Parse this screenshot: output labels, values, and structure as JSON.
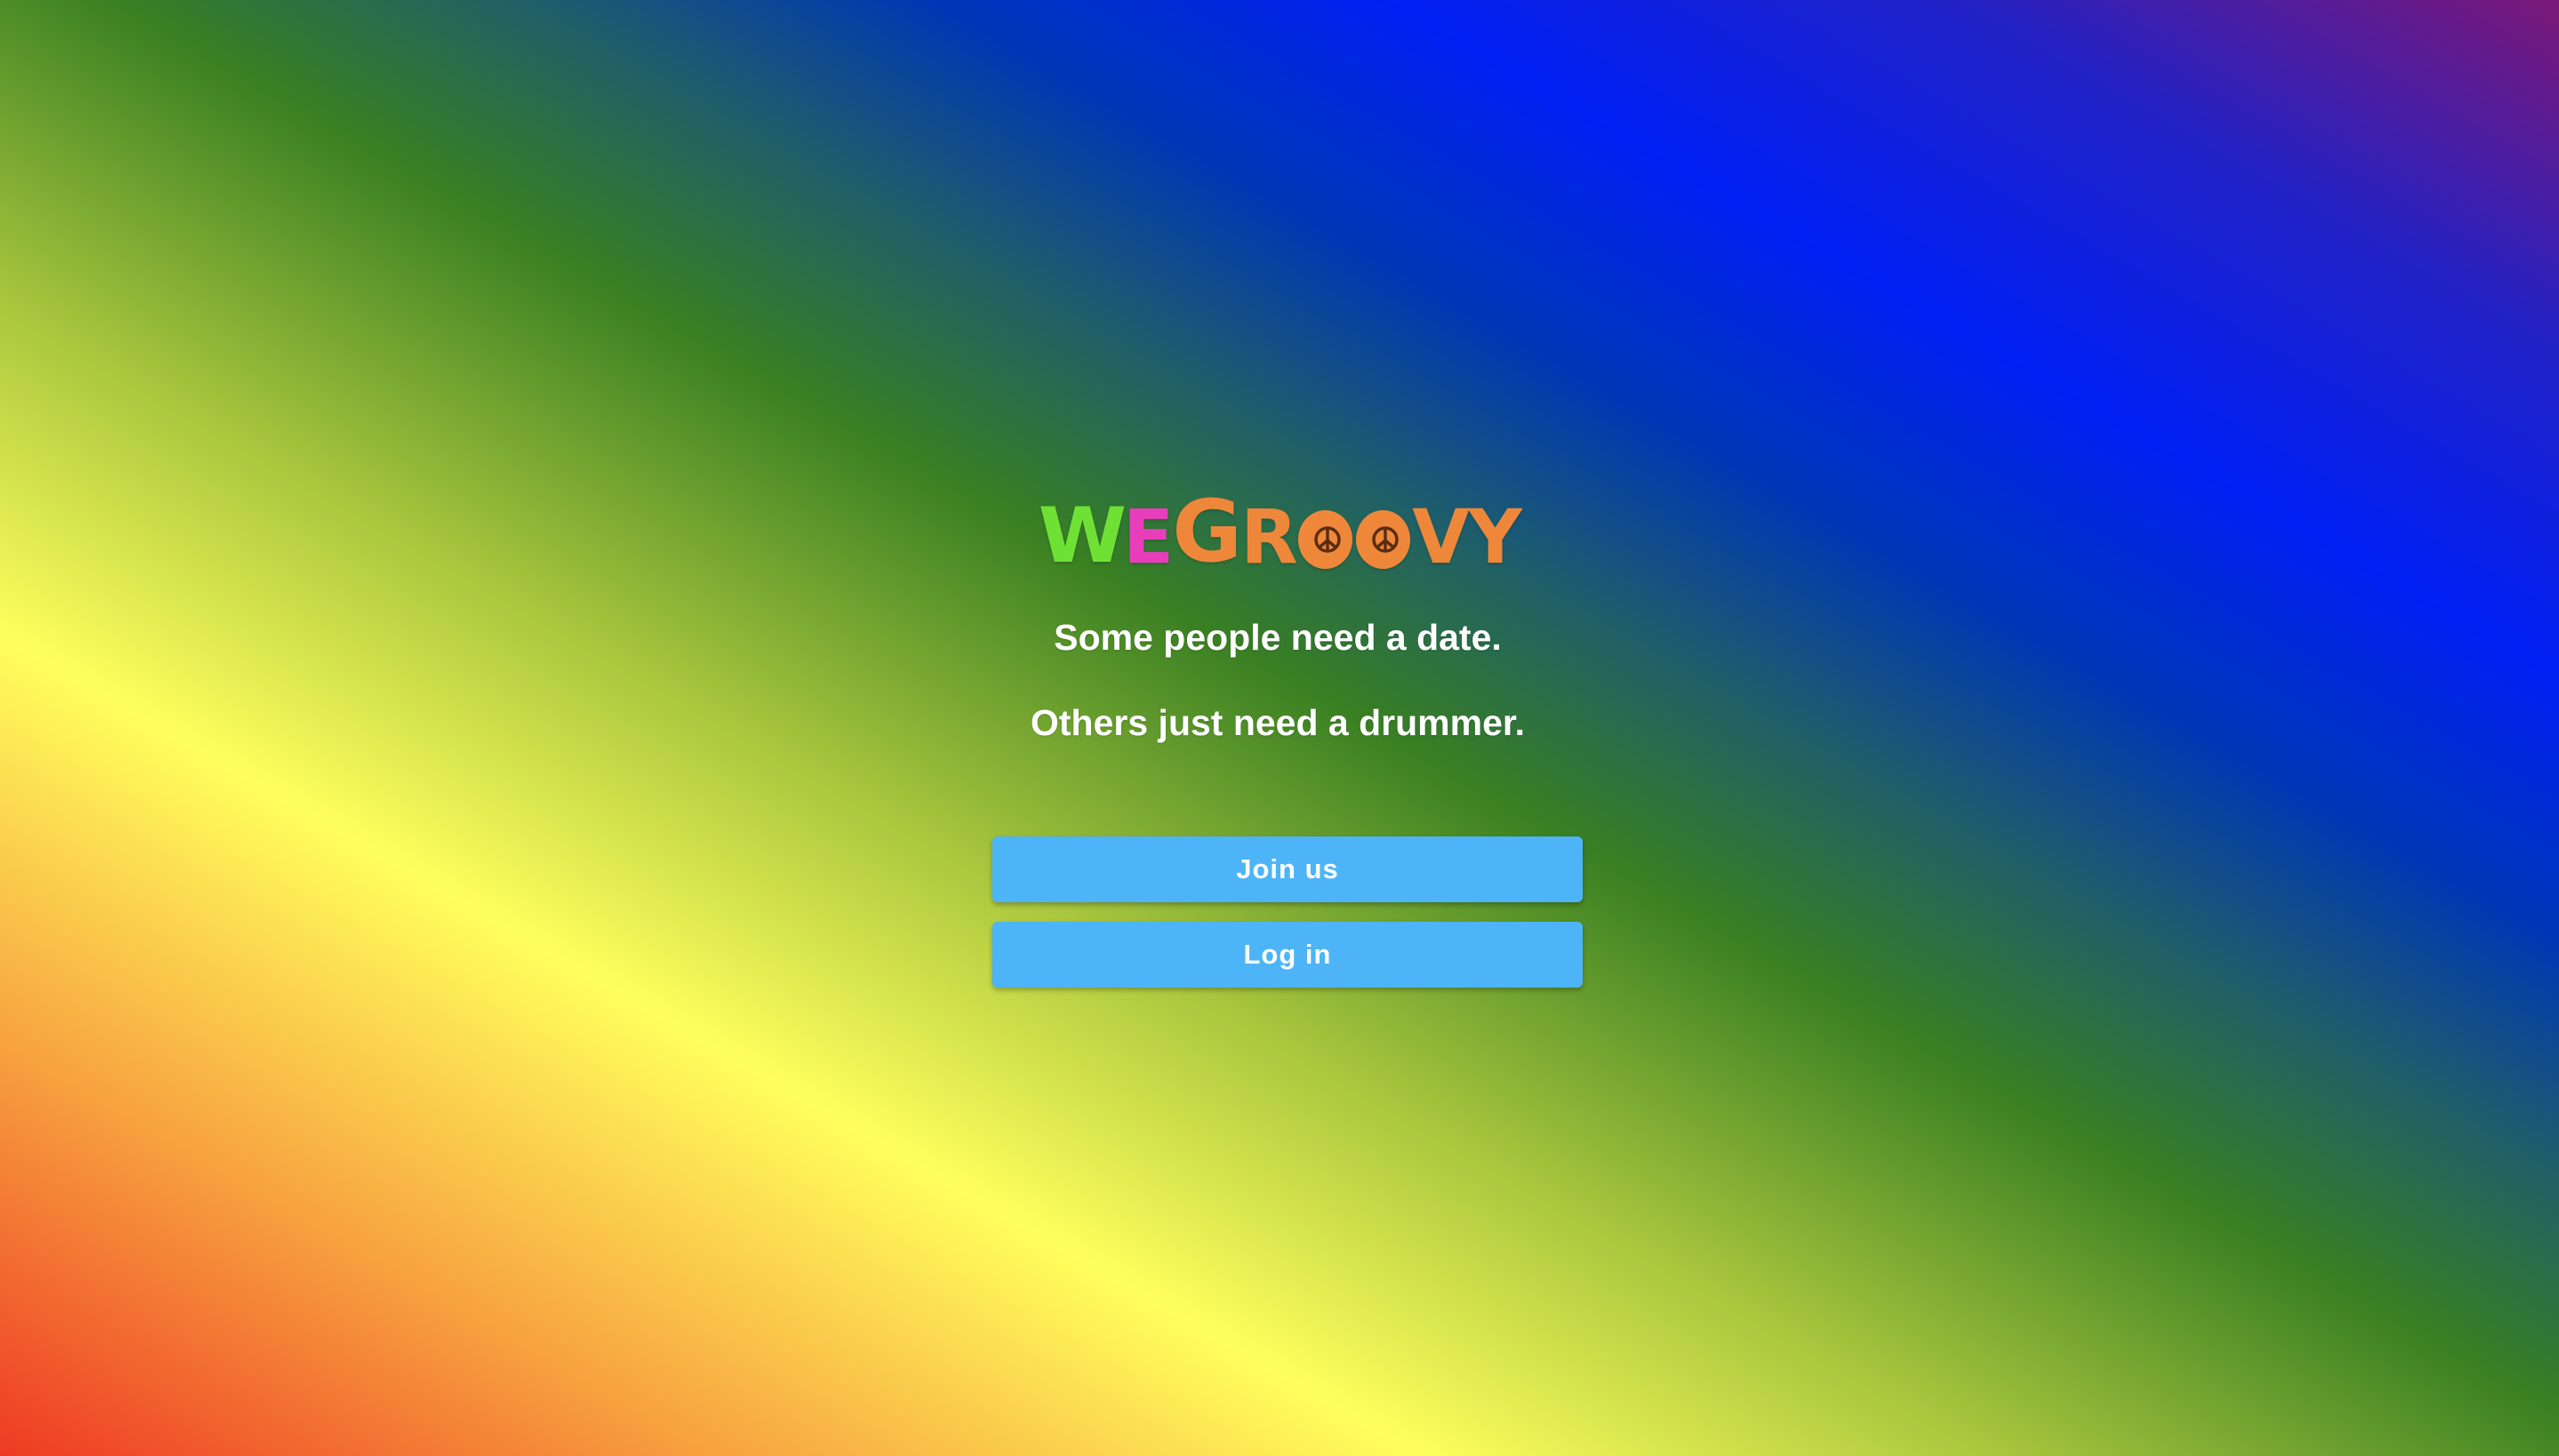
{
  "logo": {
    "letters": [
      "W",
      "E",
      "G",
      "R",
      "O",
      "O",
      "V",
      "Y"
    ],
    "text": "WEGROOVY",
    "colors": {
      "w": "#6fe135",
      "e": "#e93ebc",
      "groovy": "#ef873b"
    }
  },
  "hero": {
    "line1": "Some people need a date.",
    "line2": "Others just need a drummer."
  },
  "actions": {
    "join_label": "Join us",
    "login_label": "Log in",
    "button_color": "#4db5f7"
  },
  "background": {
    "gradient_colors": [
      "#ee3a24",
      "#f7a13f",
      "#ffff5c",
      "#a4c33c",
      "#387f22",
      "#1f5f68",
      "#0036b6",
      "#0020f4",
      "#2122c6",
      "#7b1877"
    ]
  }
}
